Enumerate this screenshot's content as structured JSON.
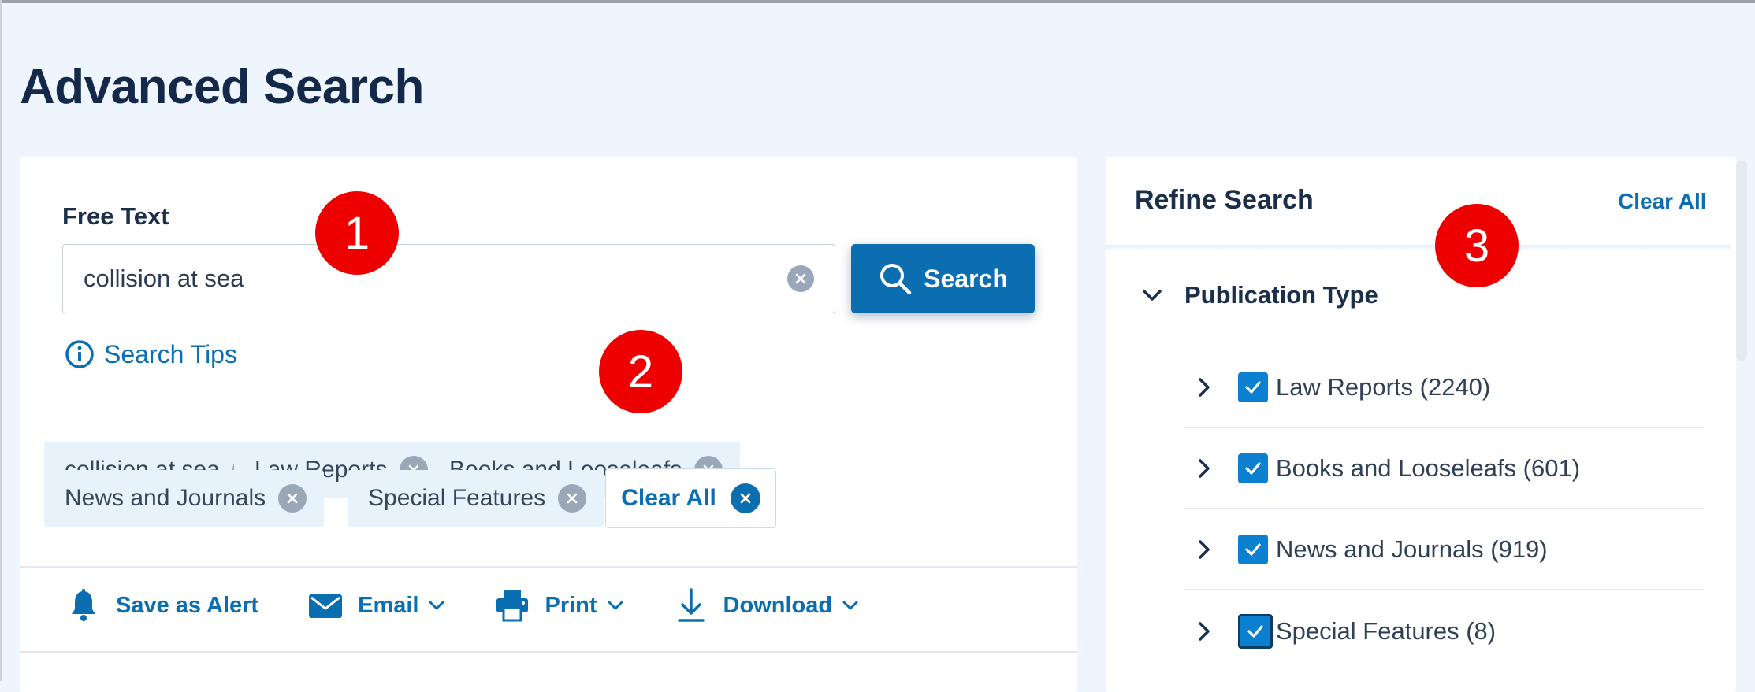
{
  "page": {
    "title": "Advanced Search"
  },
  "search": {
    "label": "Free Text",
    "value": "collision at sea",
    "button_label": "Search",
    "tips_label": "Search Tips"
  },
  "chips": [
    {
      "label": "collision at sea"
    },
    {
      "label": "Law Reports"
    },
    {
      "label": "Books and Looseleafs"
    },
    {
      "label": "News and Journals"
    },
    {
      "label": "Special Features"
    }
  ],
  "clear_all_chip": "Clear All",
  "actions": {
    "alert": "Save as Alert",
    "email": "Email",
    "print": "Print",
    "download": "Download"
  },
  "refine": {
    "title": "Refine Search",
    "clear_all": "Clear All",
    "group_title": "Publication Type",
    "facets": [
      {
        "label": "Law Reports (2240)",
        "checked": true
      },
      {
        "label": "Books and Looseleafs (601)",
        "checked": true
      },
      {
        "label": "News and Journals (919)",
        "checked": true
      },
      {
        "label": "Special Features (8)",
        "checked": true
      }
    ]
  },
  "markers": [
    "1",
    "2",
    "3"
  ],
  "colors": {
    "accent": "#0b6eb1",
    "chip_background": "#e7f2fb",
    "page_background": "#eef5fd",
    "marker": "#ef0000"
  },
  "icons": {
    "search_button": "magnifier-icon",
    "tips": "info-circle-icon",
    "alert": "bell-icon",
    "email": "envelope-icon",
    "print": "printer-icon",
    "download": "download-arrow-icon"
  }
}
